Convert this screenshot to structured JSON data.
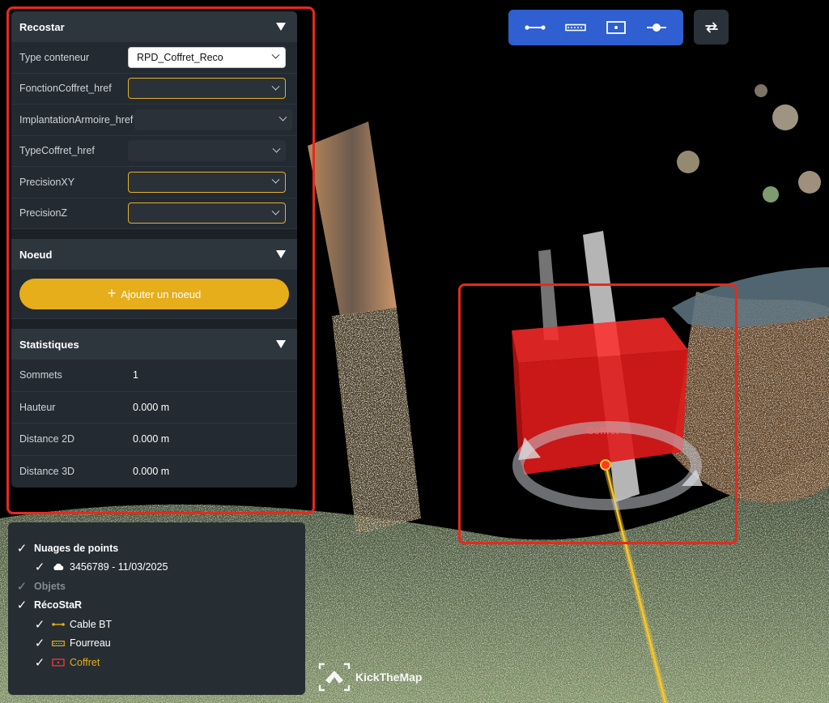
{
  "panel": {
    "recostar": {
      "title": "Recostar",
      "fields": [
        {
          "label": "Type conteneur",
          "value": "RPD_Coffret_Reco",
          "state": "selected"
        },
        {
          "label": "FonctionCoffret_href",
          "value": "",
          "state": "required"
        },
        {
          "label": "ImplantationArmoire_href",
          "value": "",
          "state": "plain"
        },
        {
          "label": "TypeCoffret_href",
          "value": "",
          "state": "plain"
        },
        {
          "label": "PrecisionXY",
          "value": "",
          "state": "required"
        },
        {
          "label": "PrecisionZ",
          "value": "",
          "state": "required"
        }
      ]
    },
    "noeud": {
      "title": "Noeud",
      "add_button": "Ajouter un noeud"
    },
    "stats": {
      "title": "Statistiques",
      "rows": [
        {
          "label": "Sommets",
          "value": "1"
        },
        {
          "label": "Hauteur",
          "value": "0.000 m"
        },
        {
          "label": "Distance 2D",
          "value": "0.000 m"
        },
        {
          "label": "Distance 3D",
          "value": "0.000 m"
        }
      ]
    }
  },
  "toolbar": {
    "tools": [
      "line-icon",
      "conduit-icon",
      "box-icon",
      "point-line-icon"
    ],
    "sync": "sync-icon"
  },
  "layers": {
    "point_clouds": {
      "label": "Nuages de points",
      "child": "3456789 - 11/03/2025"
    },
    "objects": {
      "label": "Objets"
    },
    "recostar": {
      "label": "RécoStaR",
      "children": [
        {
          "label": "Cable BT",
          "color": "#ffffff"
        },
        {
          "label": "Fourreau",
          "color": "#ffffff"
        },
        {
          "label": "Coffret",
          "color": "#e6ae1b"
        }
      ]
    }
  },
  "scene": {
    "object_label": "Coffret",
    "brand": "KickTheMap"
  },
  "colors": {
    "accent": "#e6ae1b",
    "toolbar": "#2f5fd0",
    "highlight": "#e8291c",
    "box": "#e01a1a"
  }
}
